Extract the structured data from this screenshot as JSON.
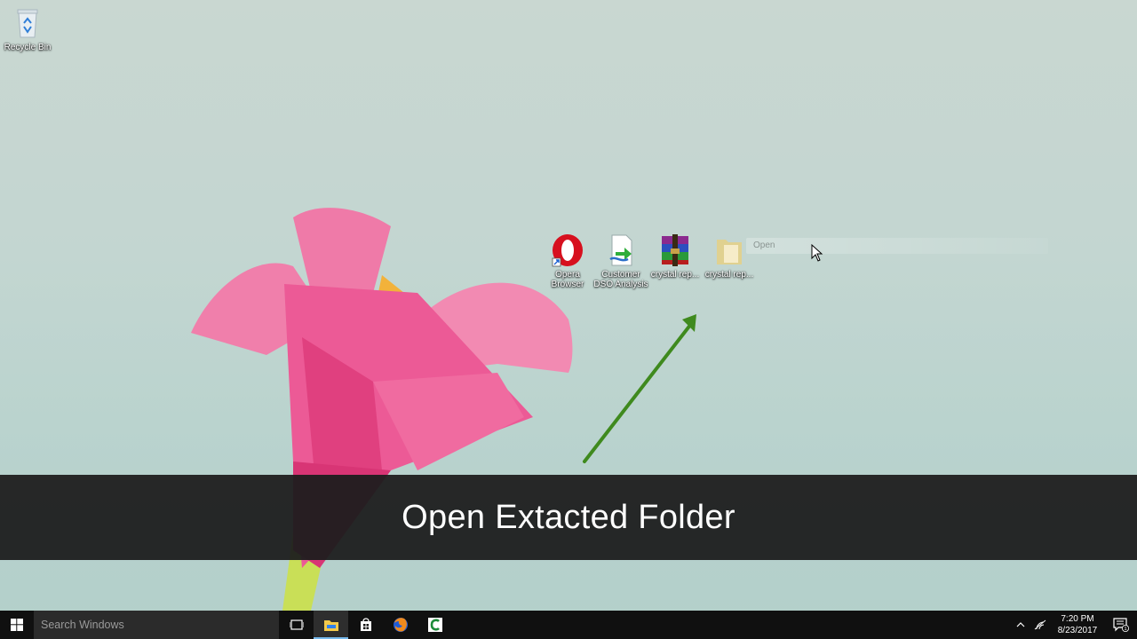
{
  "desktop": {
    "icons": [
      {
        "label": "Recycle Bin",
        "icon": "recycle-bin-icon"
      },
      {
        "label": "Opera Browser",
        "icon": "opera-icon"
      },
      {
        "label": "Customer DSO Analysis",
        "icon": "report-file-icon"
      },
      {
        "label": "crystal rep...",
        "icon": "winrar-archive-icon"
      },
      {
        "label": "crystal rep...",
        "icon": "folder-icon"
      }
    ],
    "hover_action": "Open"
  },
  "caption": {
    "text": "Open Extacted Folder"
  },
  "taskbar": {
    "search_placeholder": "Search Windows",
    "apps": [
      "task-view-icon",
      "file-explorer-icon",
      "store-icon",
      "firefox-icon",
      "crystal-reports-icon"
    ],
    "clock": {
      "time": "7:20 PM",
      "date": "8/23/2017"
    },
    "notification_count": "1"
  },
  "colors": {
    "taskbar_bg": "#101010",
    "caption_bg": "#1e1e1e",
    "arrow": "#3f8a1e",
    "accent": "#76b9ed"
  }
}
